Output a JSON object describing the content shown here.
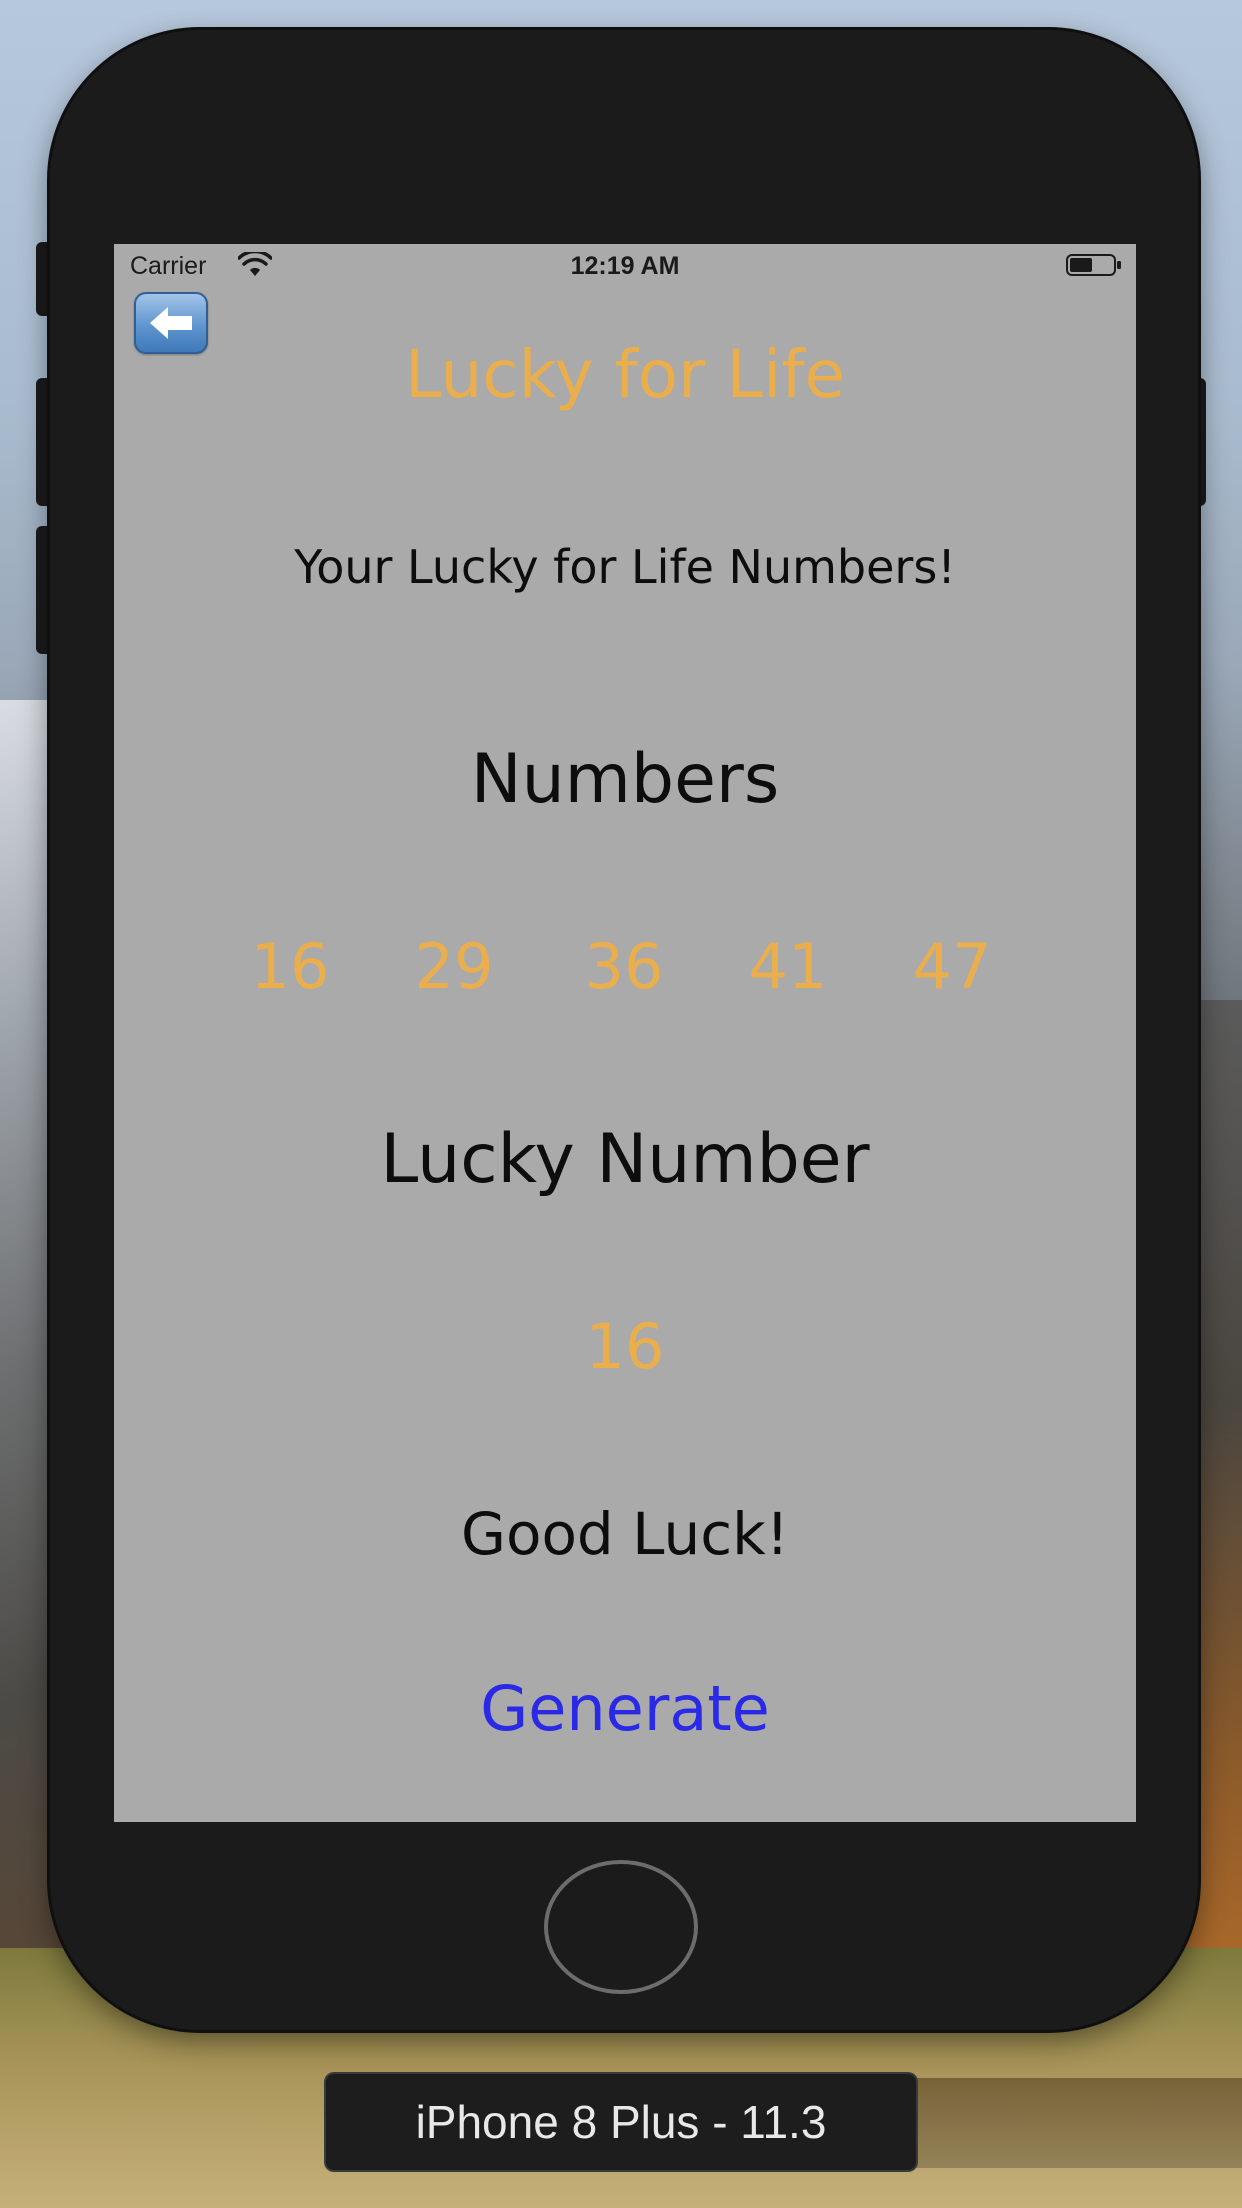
{
  "status_bar": {
    "carrier": "Carrier",
    "time": "12:19 AM"
  },
  "screen": {
    "title": "Lucky for Life",
    "subtitle": "Your Lucky for Life Numbers!",
    "numbers_heading": "Numbers",
    "numbers": [
      "16",
      "29",
      "36",
      "41",
      "47"
    ],
    "lucky_heading": "Lucky Number",
    "lucky_number": "16",
    "good_luck": "Good Luck!",
    "generate_label": "Generate"
  },
  "simulator": {
    "device_label": "iPhone 8 Plus - 11.3"
  },
  "colors": {
    "accent": "#eaae4c",
    "link": "#2a2ae6",
    "screen_bg": "#aaaaaa",
    "device_body": "#1b1b1c"
  },
  "icons": {
    "back": "back-arrow-icon",
    "wifi": "wifi-icon",
    "battery": "battery-icon"
  }
}
